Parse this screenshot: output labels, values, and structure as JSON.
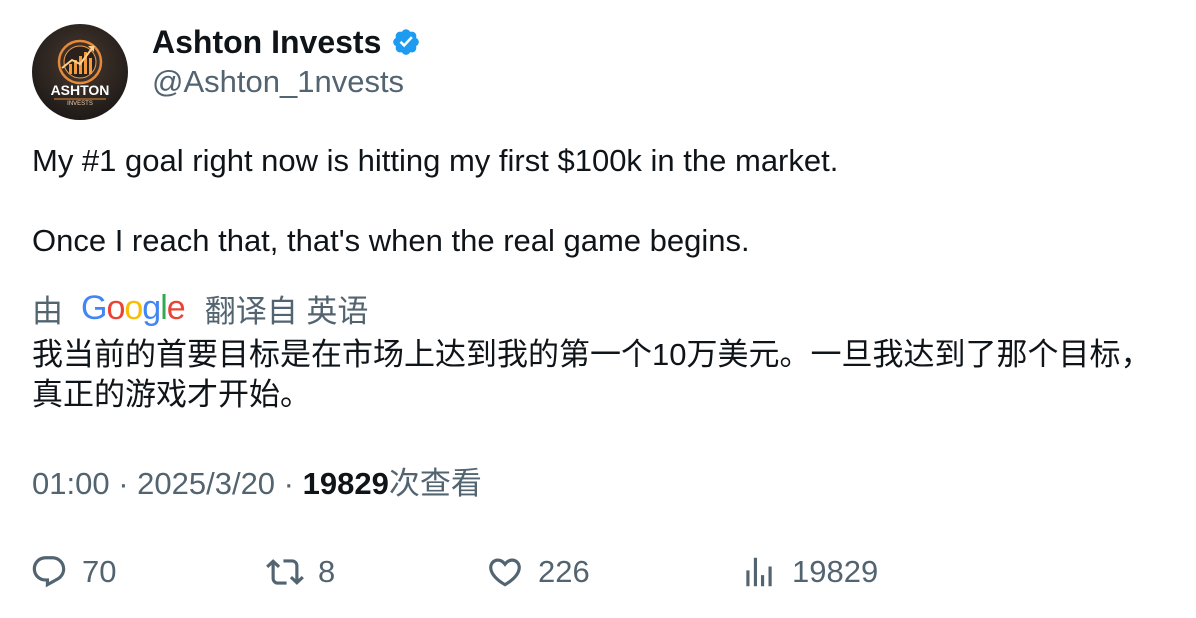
{
  "author": {
    "name": "Ashton Invests",
    "handle": "@Ashton_1nvests",
    "avatar_text": "ASHTON",
    "avatar_subtext": "INVESTS",
    "verified": true,
    "verified_color": "#1d9bf0"
  },
  "tweet": {
    "line1": "My #1 goal right now is hitting my first $100k in the market.",
    "line2": "Once I reach that, that's when the real game begins."
  },
  "translation": {
    "prefix": "由",
    "provider": "Google",
    "suffix": "翻译自 英语",
    "text": "我当前的首要目标是在市场上达到我的第一个10万美元。一旦我达到了那个目标，真正的游戏才开始。"
  },
  "meta": {
    "time": "01:00",
    "separator": " · ",
    "date": "2025/3/20",
    "views_count": "19829",
    "views_label": "次查看"
  },
  "actions": {
    "replies": {
      "icon": "reply-icon",
      "count": "70"
    },
    "retweets": {
      "icon": "retweet-icon",
      "count": "8"
    },
    "likes": {
      "icon": "heart-icon",
      "count": "226"
    },
    "views": {
      "icon": "analytics-icon",
      "count": "19829"
    }
  },
  "colors": {
    "text_primary": "#0f1419",
    "text_secondary": "#536471",
    "google_blue": "#4285f4",
    "google_red": "#ea4335",
    "google_yellow": "#fbbc05",
    "google_green": "#34a853"
  }
}
